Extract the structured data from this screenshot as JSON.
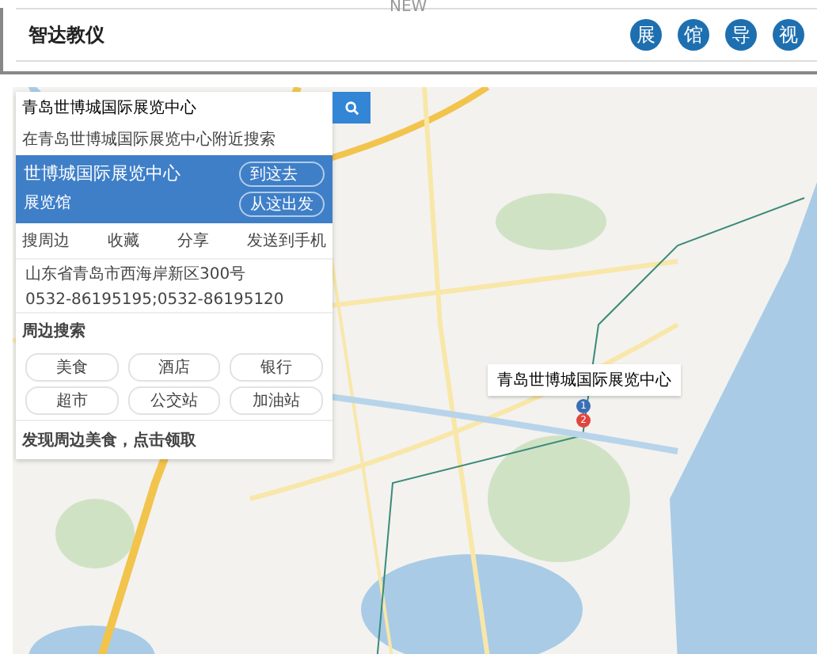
{
  "header": {
    "top_label": "NEW",
    "brand": "智达教仪",
    "badges": [
      "展",
      "馆",
      "导",
      "视"
    ]
  },
  "map": {
    "search": {
      "value": "青岛世博城国际展览中心"
    },
    "nearby_hint": "在青岛世博城国际展览中心附近搜索",
    "place": {
      "name": "世博城国际展览中心",
      "category": "展览馆",
      "buttons": [
        "到这去",
        "从这出发"
      ]
    },
    "actions": [
      "搜周边",
      "收藏",
      "分享",
      "发送到手机"
    ],
    "address": "山东省青岛市西海岸新区300号",
    "phone": "0532-86195195;0532-86195120",
    "nearby_title": "周边搜索",
    "categories": [
      "美食",
      "酒店",
      "银行",
      "超市",
      "公交站",
      "加油站"
    ],
    "promo": "发现周边美食，点击领取",
    "popup": "青岛世博城国际展览中心",
    "markers": [
      "1",
      "2"
    ]
  }
}
